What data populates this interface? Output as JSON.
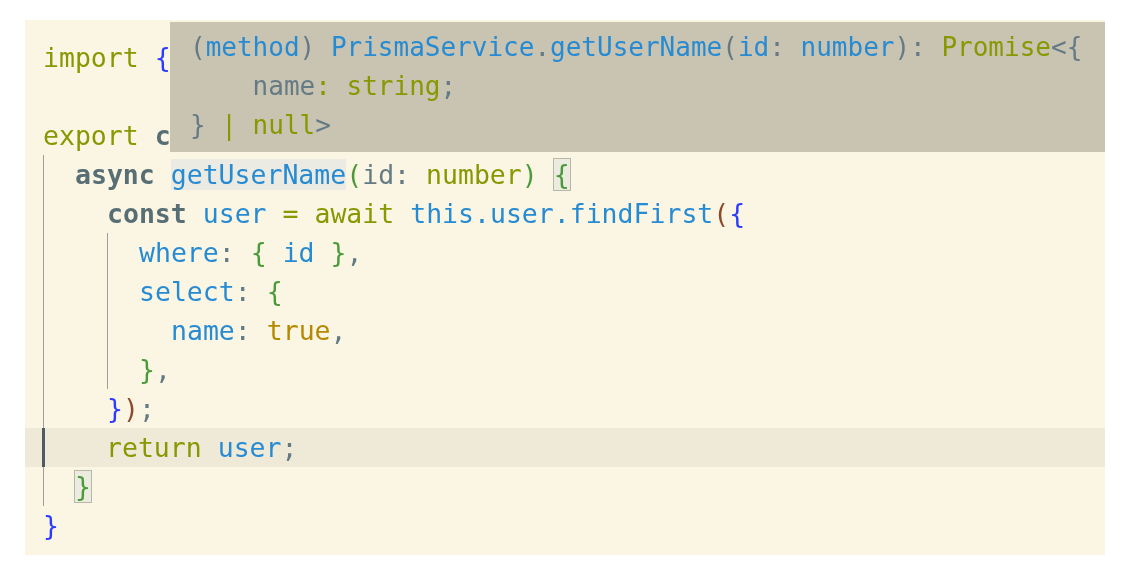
{
  "editor": {
    "lines": [
      {
        "kind": "code",
        "current": false,
        "tokens": [
          {
            "text": "import",
            "kind": "keyword"
          },
          {
            "text": " {",
            "kind": "brace1"
          }
        ]
      },
      {
        "kind": "blank",
        "current": false
      },
      {
        "kind": "code",
        "current": false,
        "tokens": [
          {
            "text": "export",
            "kind": "keyword"
          },
          {
            "text": " c",
            "kind": "storage"
          }
        ],
        "children": [
          {
            "kind": "code",
            "current": false,
            "tokens": [
              {
                "text": "async ",
                "kind": "storage"
              },
              {
                "text": "getUserName",
                "kind": "ident-selected"
              },
              {
                "text": "(",
                "kind": "brace2"
              },
              {
                "text": "id: ",
                "kind": "plain"
              },
              {
                "text": "number",
                "kind": "keyword"
              },
              {
                "text": ") ",
                "kind": "brace2"
              },
              {
                "text": "{",
                "kind": "brace2-match"
              }
            ],
            "children": [
              {
                "kind": "code",
                "current": false,
                "tokens": [
                  {
                    "text": "const ",
                    "kind": "storage"
                  },
                  {
                    "text": "user",
                    "kind": "ident"
                  },
                  {
                    "text": " = ",
                    "kind": "keyword"
                  },
                  {
                    "text": "await ",
                    "kind": "keyword"
                  },
                  {
                    "text": "this.user.findFirst",
                    "kind": "ident"
                  },
                  {
                    "text": "(",
                    "kind": "brace3"
                  },
                  {
                    "text": "{",
                    "kind": "brace1"
                  }
                ],
                "children": [
                  {
                    "kind": "code",
                    "current": false,
                    "tokens": [
                      {
                        "text": "where",
                        "kind": "ident"
                      },
                      {
                        "text": ": ",
                        "kind": "plain"
                      },
                      {
                        "text": "{ ",
                        "kind": "brace2"
                      },
                      {
                        "text": "id",
                        "kind": "ident"
                      },
                      {
                        "text": " }",
                        "kind": "brace2"
                      },
                      {
                        "text": ",",
                        "kind": "plain"
                      }
                    ]
                  },
                  {
                    "kind": "code",
                    "current": false,
                    "tokens": [
                      {
                        "text": "select",
                        "kind": "ident"
                      },
                      {
                        "text": ": ",
                        "kind": "plain"
                      },
                      {
                        "text": "{",
                        "kind": "brace2"
                      }
                    ],
                    "children": [
                      {
                        "kind": "code",
                        "current": false,
                        "tokens": [
                          {
                            "text": "name",
                            "kind": "ident"
                          },
                          {
                            "text": ": ",
                            "kind": "plain"
                          },
                          {
                            "text": "true",
                            "kind": "bool"
                          },
                          {
                            "text": ",",
                            "kind": "plain"
                          }
                        ]
                      }
                    ]
                  },
                  {
                    "kind": "code",
                    "current": false,
                    "tokens": [
                      {
                        "text": "}",
                        "kind": "brace2"
                      },
                      {
                        "text": ",",
                        "kind": "plain"
                      }
                    ]
                  }
                ]
              },
              {
                "kind": "code",
                "current": false,
                "tokens": [
                  {
                    "text": "}",
                    "kind": "brace1"
                  },
                  {
                    "text": ")",
                    "kind": "brace3"
                  },
                  {
                    "text": ";",
                    "kind": "plain"
                  }
                ]
              },
              {
                "kind": "code",
                "current": true,
                "tokens": [
                  {
                    "text": "return",
                    "kind": "keyword"
                  },
                  {
                    "text": " user",
                    "kind": "ident"
                  },
                  {
                    "text": ";",
                    "kind": "plain"
                  }
                ]
              }
            ]
          },
          {
            "kind": "code",
            "current": false,
            "tokens": [
              {
                "text": "}",
                "kind": "brace2-match"
              }
            ]
          }
        ]
      },
      {
        "kind": "code",
        "current": false,
        "tokens": [
          {
            "text": "}",
            "kind": "brace1"
          }
        ]
      }
    ]
  },
  "hover_tooltip": {
    "lines": [
      {
        "tokens": [
          {
            "text": "(",
            "kind": "plain"
          },
          {
            "text": "method",
            "kind": "ident"
          },
          {
            "text": ") ",
            "kind": "plain"
          },
          {
            "text": "PrismaService",
            "kind": "ident"
          },
          {
            "text": ".",
            "kind": "plain"
          },
          {
            "text": "getUserName",
            "kind": "ident"
          },
          {
            "text": "(",
            "kind": "plain"
          },
          {
            "text": "id",
            "kind": "ident"
          },
          {
            "text": ": ",
            "kind": "plain"
          },
          {
            "text": "number",
            "kind": "ident"
          },
          {
            "text": "): ",
            "kind": "plain"
          },
          {
            "text": "Promise",
            "kind": "keyword"
          },
          {
            "text": "<{",
            "kind": "plain"
          }
        ],
        "children": [
          {
            "tokens": [
              {
                "text": "name",
                "kind": "plain"
              },
              {
                "text": ": ",
                "kind": "keyword"
              },
              {
                "text": "string",
                "kind": "keyword"
              },
              {
                "text": ";",
                "kind": "plain"
              }
            ]
          }
        ]
      },
      {
        "tokens": [
          {
            "text": "}",
            "kind": "plain"
          },
          {
            "text": " | null",
            "kind": "keyword"
          },
          {
            "text": ">",
            "kind": "plain"
          }
        ]
      }
    ]
  }
}
